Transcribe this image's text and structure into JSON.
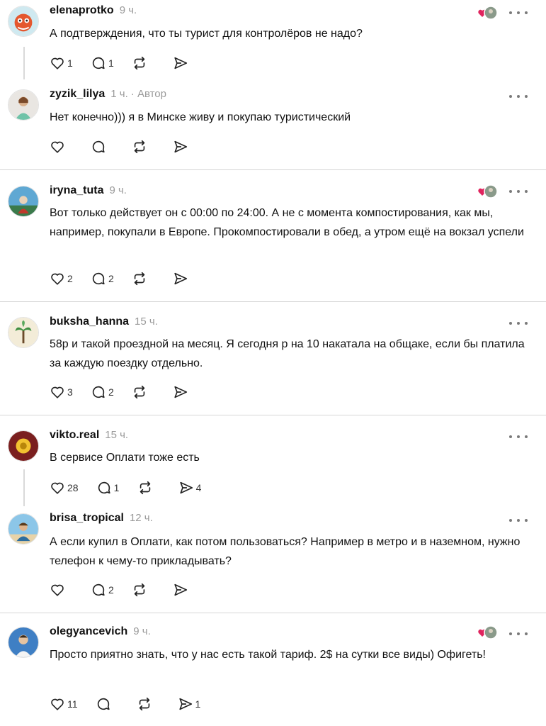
{
  "posts": [
    {
      "username": "elenaprotko",
      "time": "9 ч.",
      "author": "",
      "text": "А подтверждения, что ты турист для контролёров не надо?",
      "likes": "1",
      "replies": "1",
      "reposts": "",
      "shares": ""
    },
    {
      "username": "zyzik_lilya",
      "time": "1 ч.",
      "author": "· Автор",
      "text": "Нет конечно))) я в Минске живу и покупаю туристический",
      "likes": "",
      "replies": "",
      "reposts": "",
      "shares": ""
    },
    {
      "username": "iryna_tuta",
      "time": "9 ч.",
      "author": "",
      "text": "Вот только действует он с 00:00 по 24:00. А не с момента компостирования, как мы, например, покупали в Европе. Прокомпостировали в обед, а утром ещё на вокзал успели",
      "likes": "2",
      "replies": "2",
      "reposts": "",
      "shares": ""
    },
    {
      "username": "buksha_hanna",
      "time": "15 ч.",
      "author": "",
      "text": "58р и такой проездной на месяц. Я сегодня р на 10 накатала на общаке, если бы платила за каждую поездку отдельно.",
      "likes": "3",
      "replies": "2",
      "reposts": "",
      "shares": ""
    },
    {
      "username": "vikto.real",
      "time": "15 ч.",
      "author": "",
      "text": "В сервисе Оплати тоже есть",
      "likes": "28",
      "replies": "1",
      "reposts": "",
      "shares": "4"
    },
    {
      "username": "brisa_tropical",
      "time": "12 ч.",
      "author": "",
      "text": "А если купил в Оплати, как потом пользоваться? Например в метро и в наземном, нужно телефон к чему-то прикладывать?",
      "likes": "",
      "replies": "2",
      "reposts": "",
      "shares": ""
    },
    {
      "username": "olegyancevich",
      "time": "9 ч.",
      "author": "",
      "text": "Просто приятно знать, что у нас есть такой тариф. 2$ на сутки все виды) Офигеть!",
      "likes": "11",
      "replies": "",
      "reposts": "",
      "shares": "1"
    }
  ],
  "icons": {
    "like": "heart-icon",
    "reply": "comment-icon",
    "repost": "repost-icon",
    "share": "send-icon",
    "more": "more-options-icon",
    "liked_by_author": "liked-by-author-icon"
  },
  "colors": {
    "text": "#111111",
    "muted": "#9a9a9a",
    "heart": "#e0245e",
    "separator": "#d6d6d6"
  }
}
